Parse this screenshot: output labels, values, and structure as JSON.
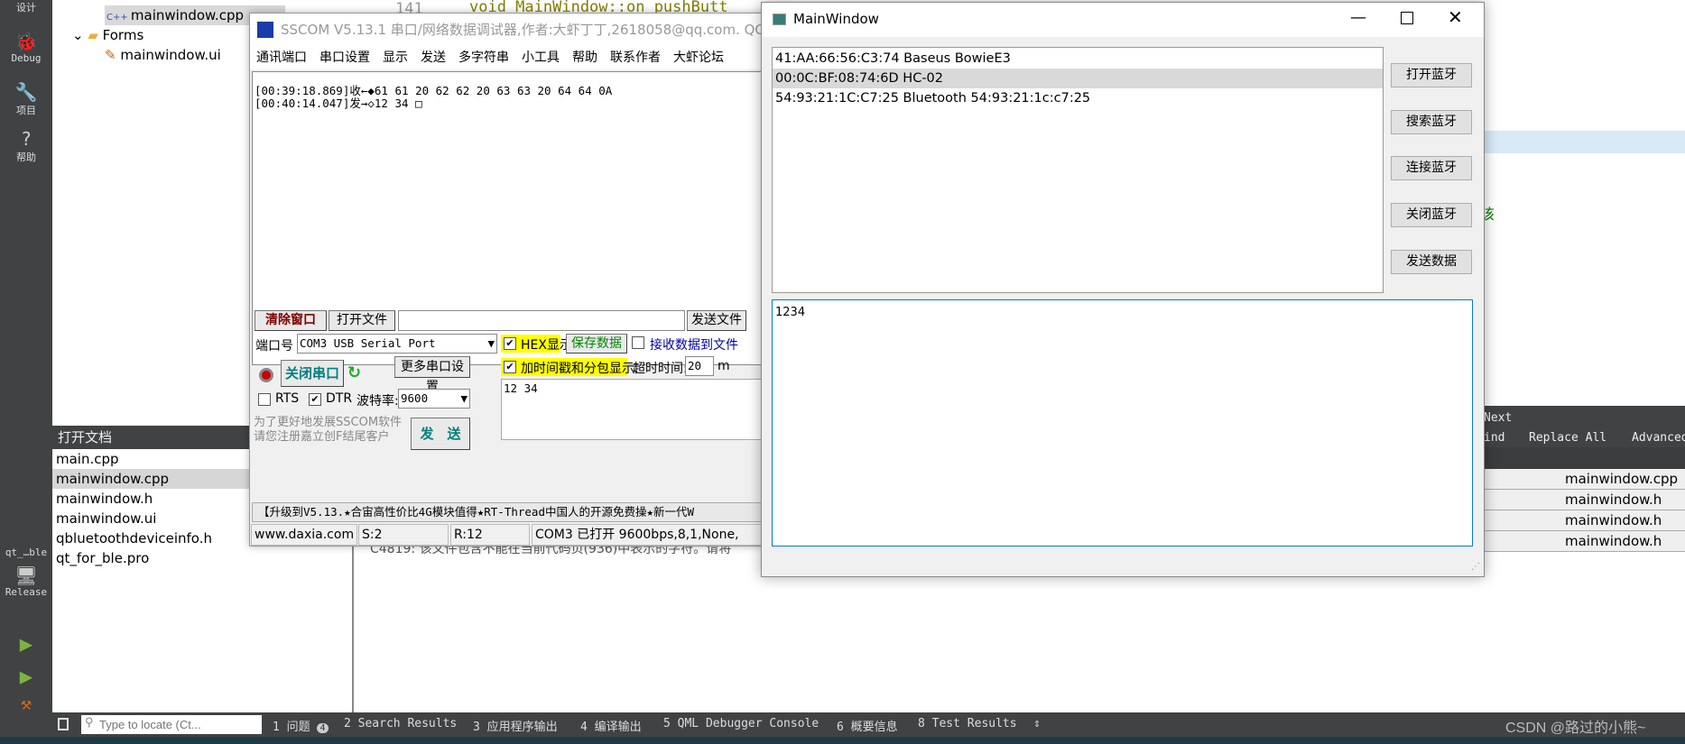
{
  "sidebar": {
    "items": [
      {
        "label": "设计",
        "icon": "design-icon"
      },
      {
        "label": "Debug",
        "icon": "bug-icon"
      },
      {
        "label": "项目",
        "icon": "wrench-icon"
      },
      {
        "label": "帮助",
        "icon": "help-icon"
      }
    ],
    "kit": "qt_…ble",
    "build_config": "Release"
  },
  "tree": {
    "items": [
      "mainwindow.cpp",
      "Forms",
      "mainwindow.ui"
    ]
  },
  "open_docs": {
    "title": "打开文档",
    "items": [
      "main.cpp",
      "mainwindow.cpp",
      "mainwindow.h",
      "mainwindow.ui",
      "qbluetoothdeviceinfo.h",
      "qt_for_ble.pro"
    ],
    "selected": 1
  },
  "editor": {
    "line_number": "141",
    "code": "void MainWindow::on_pushButt",
    "partial_char": "该",
    "issue_text": "C4819: 该文件包含不能在当前代码页(936)中表示的字符。请将"
  },
  "find": {
    "next": "Next",
    "find": "ind",
    "replace_all": "Replace All",
    "advanced": "Advanced"
  },
  "search_results": [
    "mainwindow.cpp",
    "mainwindow.h",
    "mainwindow.h",
    "mainwindow.h"
  ],
  "bottombar": {
    "locate_placeholder": "Type to locate (Ct...",
    "tabs": [
      "1 问题",
      "2 Search Results",
      "3 应用程序输出",
      "4 编译输出",
      "5 QML Debugger Console",
      "6 概要信息",
      "8 Test Results"
    ],
    "issues_count": "4",
    "watermark": "CSDN @路过的小熊~"
  },
  "sscom": {
    "title": "SSCOM V5.13.1 串口/网络数据调试器,作者:大虾丁丁,2618058@qq.com. QQ群",
    "menu": [
      "通讯端口",
      "串口设置",
      "显示",
      "发送",
      "多字符串",
      "小工具",
      "帮助",
      "联系作者",
      "大虾论坛"
    ],
    "receive_lines": [
      "[00:39:18.869]收←◆61 61 20 62 62 20 63 63 20 64 64 0A",
      "[00:40:14.047]发→◇12 34 □"
    ],
    "clear_button": "清除窗口",
    "open_file_button": "打开文件",
    "file_path": "",
    "send_file_button": "发送文件",
    "port_label": "端口号",
    "port_value": "COM3 USB Serial Port",
    "hex_display": "HEX显示",
    "hex_checked": true,
    "save_data": "保存数据",
    "recv_to_file": "接收数据到文件",
    "recv_to_file_checked": false,
    "close_port": "关闭串口",
    "more_settings": "更多串口设置",
    "timestamp_label": "加时间戳和分包显示,",
    "timestamp_checked": true,
    "timeout_label": "超时时间:",
    "timeout_value": "20",
    "timeout_unit": "m",
    "rts": "RTS",
    "rts_checked": false,
    "dtr": "DTR",
    "dtr_checked": true,
    "baud_label": "波特率:",
    "baud_value": "9600",
    "send_text": "12 34",
    "promo": "为了更好地发展SSCOM软件\n请您注册嘉立创F结尾客户",
    "send_button": "发　送",
    "ticker": "【升级到V5.13.★合宙高性价比4G模块值得★RT-Thread中国人的开源免费操★新一代W",
    "status": {
      "site": "www.daxia.com",
      "sent": "S:2",
      "received": "R:12",
      "port_status": "COM3 已打开  9600bps,8,1,None,"
    }
  },
  "mainwindow": {
    "title": "MainWindow",
    "devices": [
      "41:AA:66:56:C3:74 Baseus BowieE3",
      "00:0C:BF:08:74:6D HC-02",
      "54:93:21:1C:C7:25 Bluetooth 54:93:21:1c:c7:25"
    ],
    "selected_device": 1,
    "buttons": [
      "打开蓝牙",
      "搜索蓝牙",
      "连接蓝牙",
      "关闭蓝牙",
      "发送数据"
    ],
    "text": "1234"
  },
  "colors": {
    "dark_panel": "#404244",
    "accent_blue": "#0078d7",
    "highlight": "#ffff00",
    "teal_text": "#007f7f",
    "dark_red_text": "#800000"
  }
}
